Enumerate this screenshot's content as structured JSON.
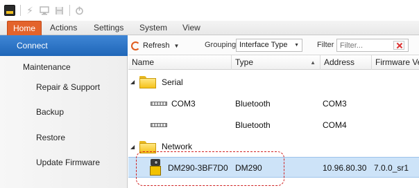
{
  "toolbar_quick": {
    "icons": [
      "app-icon",
      "lightning-icon",
      "monitor-icon",
      "save-icon",
      "power-icon"
    ]
  },
  "ribbon": {
    "tabs": [
      {
        "label": "Home",
        "active": true
      },
      {
        "label": "Actions",
        "active": false
      },
      {
        "label": "Settings",
        "active": false
      },
      {
        "label": "System",
        "active": false
      },
      {
        "label": "View",
        "active": false
      }
    ],
    "accent_color": "#e3632c"
  },
  "nav": {
    "items": [
      {
        "label": "Connect",
        "type": "selected"
      },
      {
        "label": "Maintenance",
        "type": "group"
      },
      {
        "label": "Repair & Support",
        "type": "sub"
      },
      {
        "label": "Backup",
        "type": "sub"
      },
      {
        "label": "Restore",
        "type": "sub"
      },
      {
        "label": "Update Firmware",
        "type": "sub"
      }
    ],
    "selected_color": "#2a74c7"
  },
  "list_toolbar": {
    "refresh_label": "Refresh",
    "grouping_label": "Grouping",
    "grouping_value": "Interface Type",
    "filter_label": "Filter",
    "filter_placeholder": "Filter..."
  },
  "columns": [
    "Name",
    "Type",
    "Address",
    "Firmware Ve"
  ],
  "groups": [
    {
      "name": "Serial",
      "rows": [
        {
          "name": "COM3",
          "type": "Bluetooth",
          "address": "COM3",
          "firmware": ""
        },
        {
          "name": "",
          "type": "Bluetooth",
          "address": "COM4",
          "firmware": ""
        }
      ]
    },
    {
      "name": "Network",
      "rows": [
        {
          "name": "DM290-3BF7D0",
          "type": "DM290",
          "address": "10.96.80.30",
          "firmware": "7.0.0_sr1"
        }
      ]
    }
  ],
  "highlight_color": "#cde3f8",
  "callout_color": "#d02020"
}
